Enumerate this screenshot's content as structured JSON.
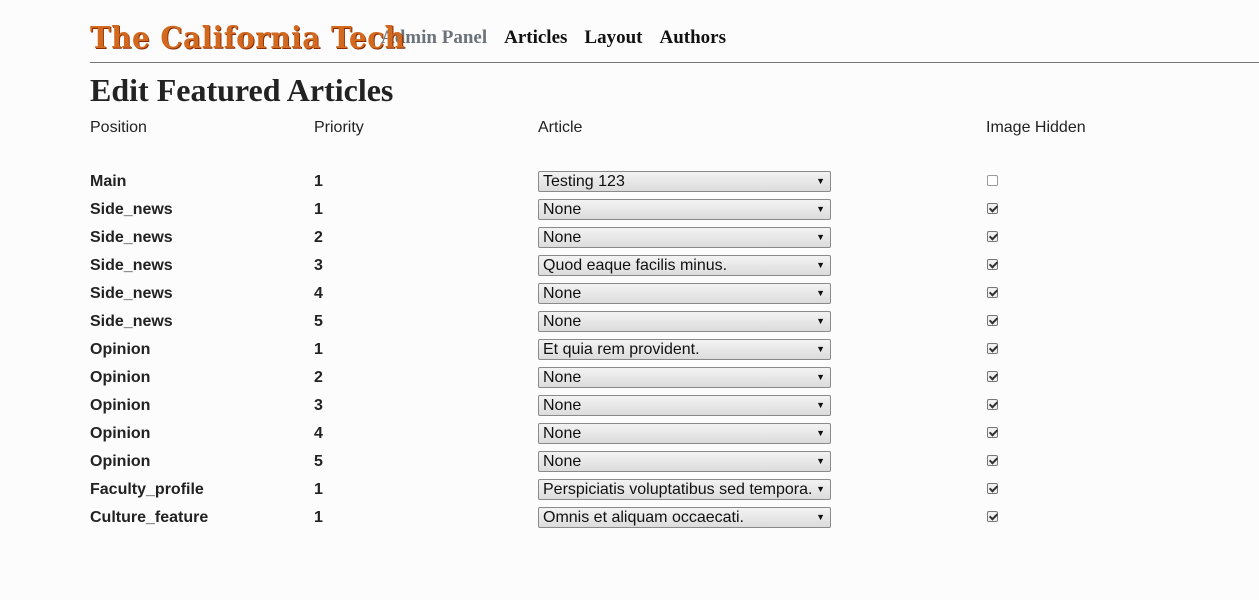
{
  "header": {
    "logo_text": "The California Tech",
    "nav": {
      "admin_panel": "Admin Panel",
      "articles": "Articles",
      "layout": "Layout",
      "authors": "Authors"
    }
  },
  "page_title": "Edit Featured Articles",
  "table": {
    "columns": {
      "position": "Position",
      "priority": "Priority",
      "article": "Article",
      "image_hidden": "Image Hidden"
    },
    "rows": [
      {
        "position": "Main",
        "priority": "1",
        "article": "Testing 123",
        "image_hidden": false
      },
      {
        "position": "Side_news",
        "priority": "1",
        "article": "None",
        "image_hidden": true
      },
      {
        "position": "Side_news",
        "priority": "2",
        "article": "None",
        "image_hidden": true
      },
      {
        "position": "Side_news",
        "priority": "3",
        "article": "Quod eaque facilis minus.",
        "image_hidden": true
      },
      {
        "position": "Side_news",
        "priority": "4",
        "article": "None",
        "image_hidden": true
      },
      {
        "position": "Side_news",
        "priority": "5",
        "article": "None",
        "image_hidden": true
      },
      {
        "position": "Opinion",
        "priority": "1",
        "article": "Et quia rem provident.",
        "image_hidden": true
      },
      {
        "position": "Opinion",
        "priority": "2",
        "article": "None",
        "image_hidden": true
      },
      {
        "position": "Opinion",
        "priority": "3",
        "article": "None",
        "image_hidden": true
      },
      {
        "position": "Opinion",
        "priority": "4",
        "article": "None",
        "image_hidden": true
      },
      {
        "position": "Opinion",
        "priority": "5",
        "article": "None",
        "image_hidden": true
      },
      {
        "position": "Faculty_profile",
        "priority": "1",
        "article": "Perspiciatis voluptatibus sed tempora.",
        "image_hidden": true
      },
      {
        "position": "Culture_feature",
        "priority": "1",
        "article": "Omnis et aliquam occaecati.",
        "image_hidden": true
      }
    ]
  },
  "colors": {
    "logo": "#d2691e",
    "nav_muted": "#6b727a",
    "text": "#222222"
  },
  "icons": {
    "dropdown": "chevron-down-icon",
    "checkbox": "checkbox-icon"
  }
}
